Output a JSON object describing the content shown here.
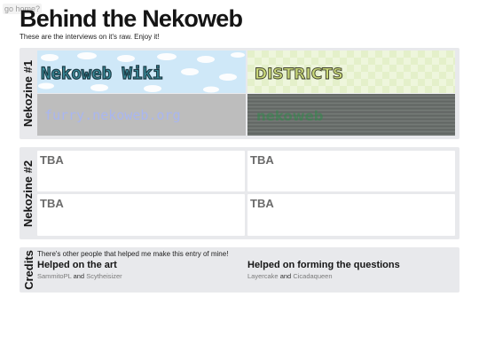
{
  "nav": {
    "go_home": "go home?"
  },
  "page": {
    "title": "Behind the Nekoweb",
    "subtitle": "These are the interviews on it's raw. Enjoy it!"
  },
  "nekozine1": {
    "label": "Nekozine #1",
    "tiles": [
      {
        "text": "Nekoweb Wiki",
        "bg": "#cfe8f8",
        "fg": "#3a8f9e"
      },
      {
        "text": "DISTRICTS",
        "bg": "#eef6dc",
        "fg": "#c9d879"
      },
      {
        "text": "furry.nekoweb.org",
        "bg": "#bdbdbd",
        "fg": "#a9b6f0"
      },
      {
        "text": "nekoweb",
        "bg": "#6a6f6c",
        "fg": "#2f8a4a"
      }
    ]
  },
  "nekozine2": {
    "label": "Nekozine #2",
    "cells": [
      "TBA",
      "TBA",
      "TBA",
      "TBA"
    ]
  },
  "credits": {
    "label": "Credits",
    "intro": "There's other people that helped me make this entry of mine!",
    "art": {
      "heading": "Helped on the art",
      "name1": "SammitoPL",
      "and": "and",
      "name2": "Scytheisizer"
    },
    "questions": {
      "heading": "Helped on forming the questions",
      "name1": "Layercake",
      "and": "and",
      "name2": "Cicadaqueen"
    }
  }
}
